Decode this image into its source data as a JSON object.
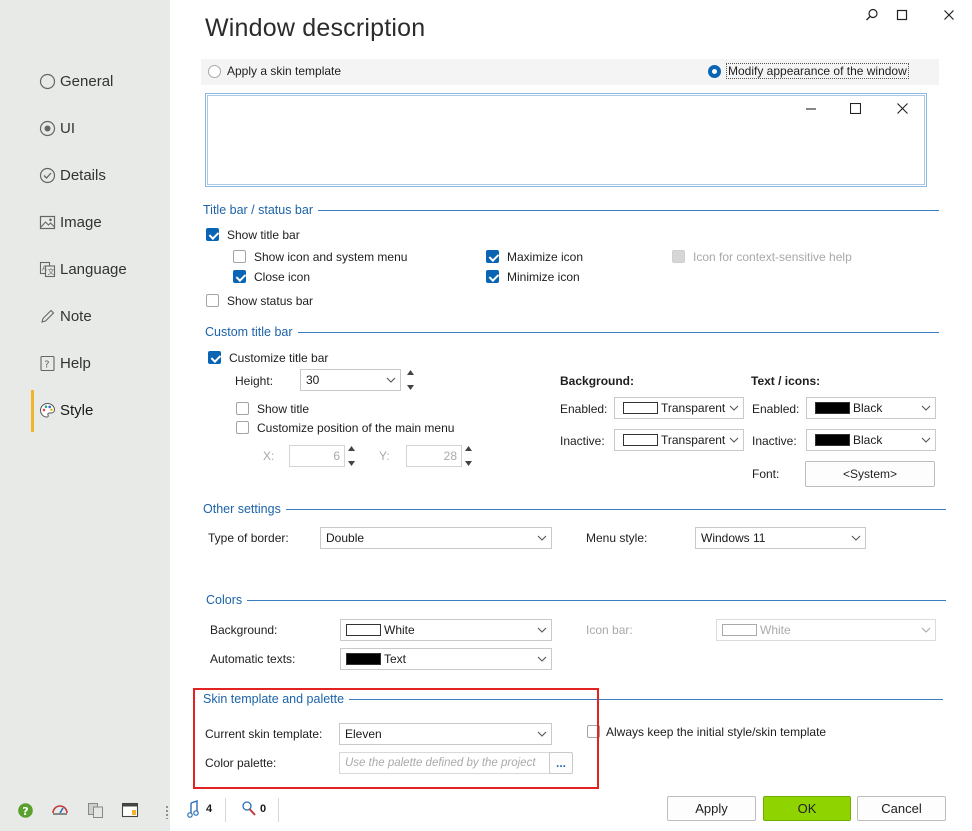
{
  "title": "Window description",
  "window_buttons": {
    "search_icon": "magnifier-icon",
    "maximize_icon": "maximize-icon",
    "close_icon": "close-icon"
  },
  "sidebar": {
    "items": [
      {
        "label": "General",
        "icon": "radio-circle-icon"
      },
      {
        "label": "UI",
        "icon": "eye-icon"
      },
      {
        "label": "Details",
        "icon": "check-circle-icon"
      },
      {
        "label": "Image",
        "icon": "image-icon"
      },
      {
        "label": "Language",
        "icon": "translate-icon"
      },
      {
        "label": "Note",
        "icon": "pencil-icon"
      },
      {
        "label": "Help",
        "icon": "help-icon"
      },
      {
        "label": "Style",
        "icon": "palette-icon"
      }
    ],
    "active": "Style",
    "bottom_icons": [
      "help-circle-icon",
      "scale-icon",
      "translate-icon",
      "window-icon"
    ]
  },
  "mode": {
    "option1": "Apply a skin template",
    "option2": "Modify appearance of the window",
    "selected": "option2"
  },
  "title_bar_section": {
    "header": "Title bar / status bar",
    "show_title_bar": {
      "label": "Show title bar",
      "checked": true
    },
    "show_icon_menu": {
      "label": "Show icon and system menu",
      "checked": false
    },
    "close_icon": {
      "label": "Close icon",
      "checked": true
    },
    "maximize_icon": {
      "label": "Maximize icon",
      "checked": true
    },
    "minimize_icon": {
      "label": "Minimize icon",
      "checked": true
    },
    "context_help": {
      "label": "Icon for context-sensitive help",
      "checked": false,
      "disabled": true
    },
    "show_status_bar": {
      "label": "Show status bar",
      "checked": false
    }
  },
  "custom_title_bar": {
    "header": "Custom title bar",
    "customize": {
      "label": "Customize title bar",
      "checked": true
    },
    "height_label": "Height:",
    "height_value": "30",
    "show_title": {
      "label": "Show title",
      "checked": false
    },
    "customize_menu_pos": {
      "label": "Customize position of the main menu",
      "checked": false
    },
    "x_label": "X:",
    "x_value": "6",
    "y_label": "Y:",
    "y_value": "28",
    "background_header": "Background:",
    "text_icons_header": "Text / icons:",
    "enabled_label": "Enabled:",
    "inactive_label": "Inactive:",
    "bg_enabled": "Transparent",
    "bg_inactive": "Transparent",
    "text_enabled": "Black",
    "text_inactive": "Black",
    "font_label": "Font:",
    "font_value": "<System>"
  },
  "other_settings": {
    "header": "Other settings",
    "border_label": "Type of border:",
    "border_value": "Double",
    "menu_style_label": "Menu style:",
    "menu_style_value": "Windows 11"
  },
  "colors": {
    "header": "Colors",
    "background_label": "Background:",
    "background_value": "White",
    "auto_texts_label": "Automatic texts:",
    "auto_texts_value": "Text",
    "icon_bar_label": "Icon bar:",
    "icon_bar_value": "White"
  },
  "skin": {
    "header": "Skin template and palette",
    "current_label": "Current skin template:",
    "current_value": "Eleven",
    "palette_label": "Color palette:",
    "palette_placeholder": "Use the palette defined by the project",
    "ellipsis": "...",
    "keep_initial": {
      "label": "Always keep the initial style/skin template",
      "checked": false
    }
  },
  "status": {
    "count1": "4",
    "count2": "0"
  },
  "buttons": {
    "apply": "Apply",
    "ok": "OK",
    "cancel": "Cancel"
  },
  "colors_theme": {
    "accent": "#0a64b4",
    "section_blue": "#1c63a8",
    "ok_green": "#8fd400",
    "sidebar_bg": "#e8eae7",
    "active_marker": "#f0b52b",
    "highlight_red": "#e32222"
  }
}
